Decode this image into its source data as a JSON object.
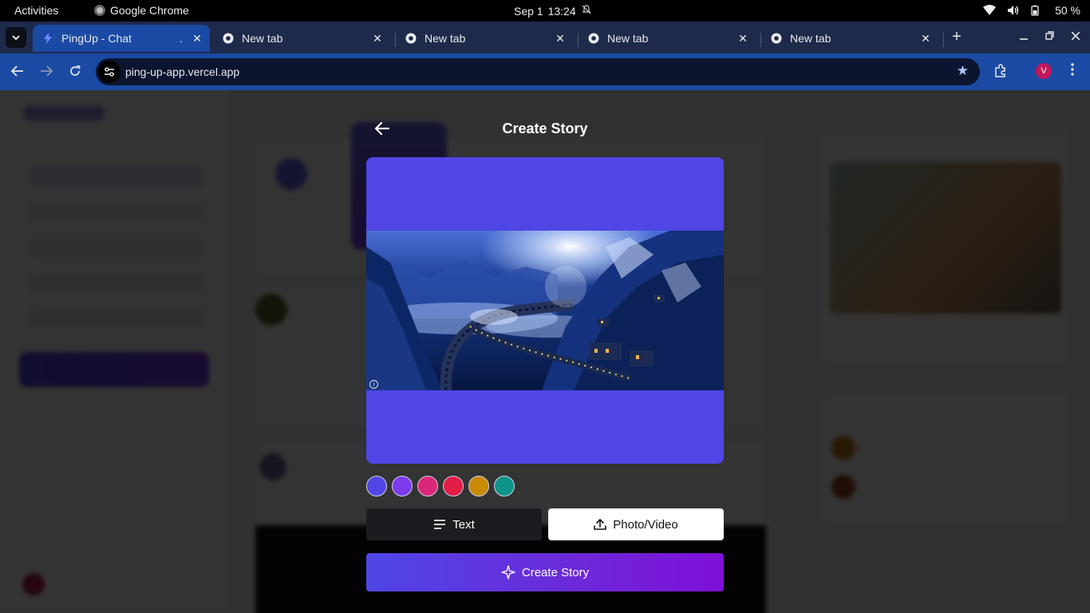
{
  "os": {
    "activities": "Activities",
    "app_name": "Google Chrome",
    "date": "Sep 1",
    "time": "13:24",
    "battery": "50 %"
  },
  "browser": {
    "tabs": [
      {
        "title": "PingUp - Chat",
        "active": true
      },
      {
        "title": "New tab",
        "active": false
      },
      {
        "title": "New tab",
        "active": false
      },
      {
        "title": "New tab",
        "active": false
      },
      {
        "title": "New tab",
        "active": false
      }
    ],
    "url": "ping-up-app.vercel.app",
    "profile_initial": "V"
  },
  "modal": {
    "title": "Create Story",
    "colors": [
      "#4f46e5",
      "#7c3aed",
      "#db2777",
      "#e11d48",
      "#ca8a04",
      "#0d9488"
    ],
    "text_button": "Text",
    "media_button": "Photo/Video",
    "create_button": "Create Story",
    "background_color": "#4f46e5"
  },
  "icons": {
    "back": "arrow-left-icon",
    "text": "text-lines-icon",
    "upload": "upload-icon",
    "sparkle": "sparkle-icon"
  }
}
